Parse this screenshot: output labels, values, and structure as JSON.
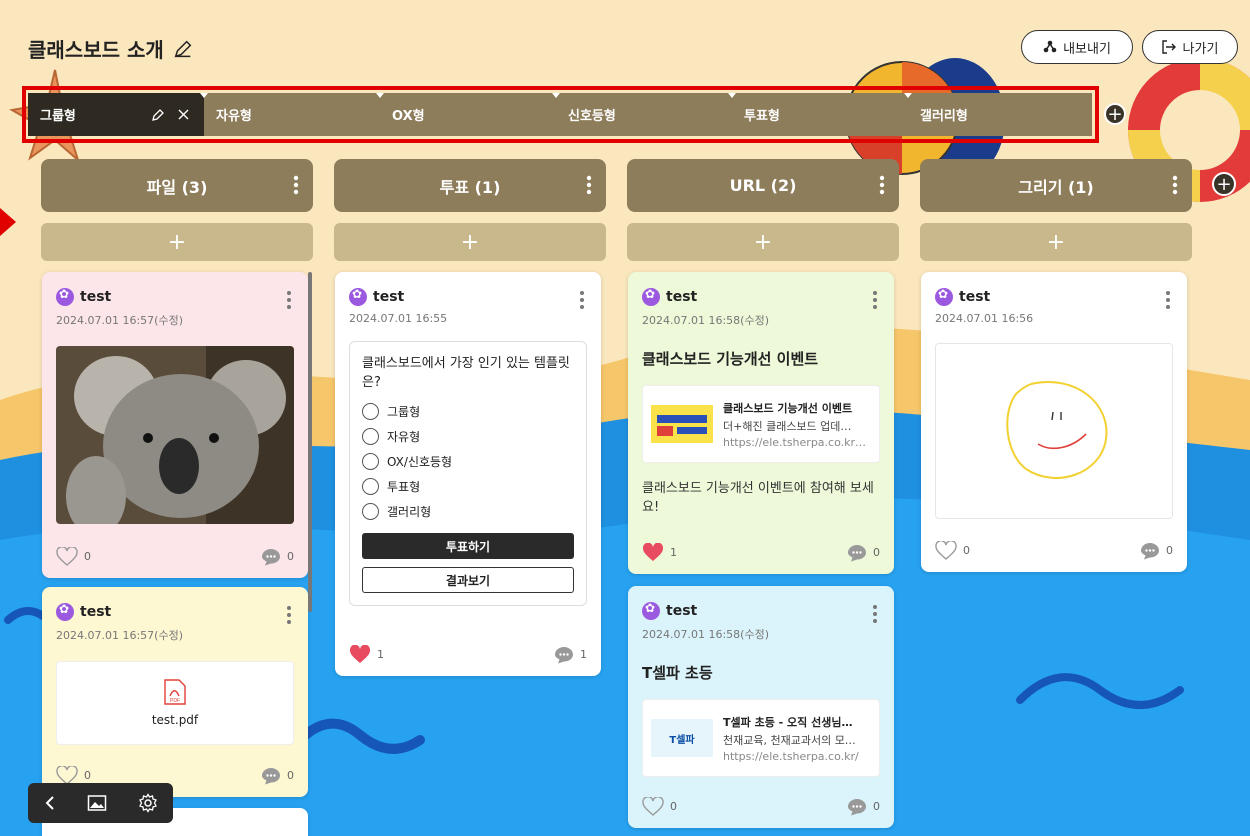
{
  "page": {
    "title": "클래스보드 소개"
  },
  "header": {
    "export_label": "내보내기",
    "exit_label": "나가기"
  },
  "tabs": [
    {
      "label": "그룹형",
      "active": true
    },
    {
      "label": "자유형"
    },
    {
      "label": "OX형"
    },
    {
      "label": "신호등형"
    },
    {
      "label": "투표형"
    },
    {
      "label": "갤러리형"
    }
  ],
  "columns": [
    {
      "title": "파일 (3)"
    },
    {
      "title": "투표 (1)"
    },
    {
      "title": "URL (2)"
    },
    {
      "title": "그리기 (1)"
    }
  ],
  "cards": {
    "file1": {
      "author": "test",
      "date": "2024.07.01 16:57(수정)",
      "likes": "0",
      "comments": "0"
    },
    "file2": {
      "author": "test",
      "date": "2024.07.01 16:57(수정)",
      "filename": "test.pdf",
      "likes": "0",
      "comments": "0"
    },
    "poll": {
      "author": "test",
      "date": "2024.07.01 16:55",
      "question": "클래스보드에서 가장 인기 있는 템플릿은?",
      "options": [
        "그룹형",
        "자유형",
        "OX/신호등형",
        "투표형",
        "갤러리형"
      ],
      "vote_label": "투표하기",
      "result_label": "결과보기",
      "likes": "1",
      "comments": "1"
    },
    "url1": {
      "author": "test",
      "date": "2024.07.01 16:58(수정)",
      "title": "클래스보드 기능개선 이벤트",
      "link_title": "클래스보드 기능개선 이벤트",
      "link_desc": "더+해진 클래스보드 업데…",
      "link_url": "https://ele.tsherpa.co.kr…",
      "body": "클래스보드 기능개선 이벤트에 참여해 보세요!",
      "likes": "1",
      "comments": "0"
    },
    "url2": {
      "author": "test",
      "date": "2024.07.01 16:58(수정)",
      "title": "T셀파 초등",
      "link_title": "T셀파 초등 - 오직 선생님…",
      "link_desc": "천재교육, 천재교과서의 모…",
      "link_url": "https://ele.tsherpa.co.kr/",
      "thumb_text": "T셀파",
      "likes": "0",
      "comments": "0"
    },
    "draw": {
      "author": "test",
      "date": "2024.07.01 16:56",
      "likes": "0",
      "comments": "0"
    }
  },
  "colors": {
    "tab_bar": "#8e7d5b",
    "active_tab": "#2e2a22",
    "column_add": "#c9b88c",
    "highlight": "#e00000"
  },
  "icons": [
    "pencil-icon",
    "export-icon",
    "exit-icon",
    "close-icon",
    "kebab-icon",
    "heart-icon",
    "comment-icon",
    "pdf-icon",
    "back-icon",
    "image-icon",
    "settings-icon"
  ]
}
